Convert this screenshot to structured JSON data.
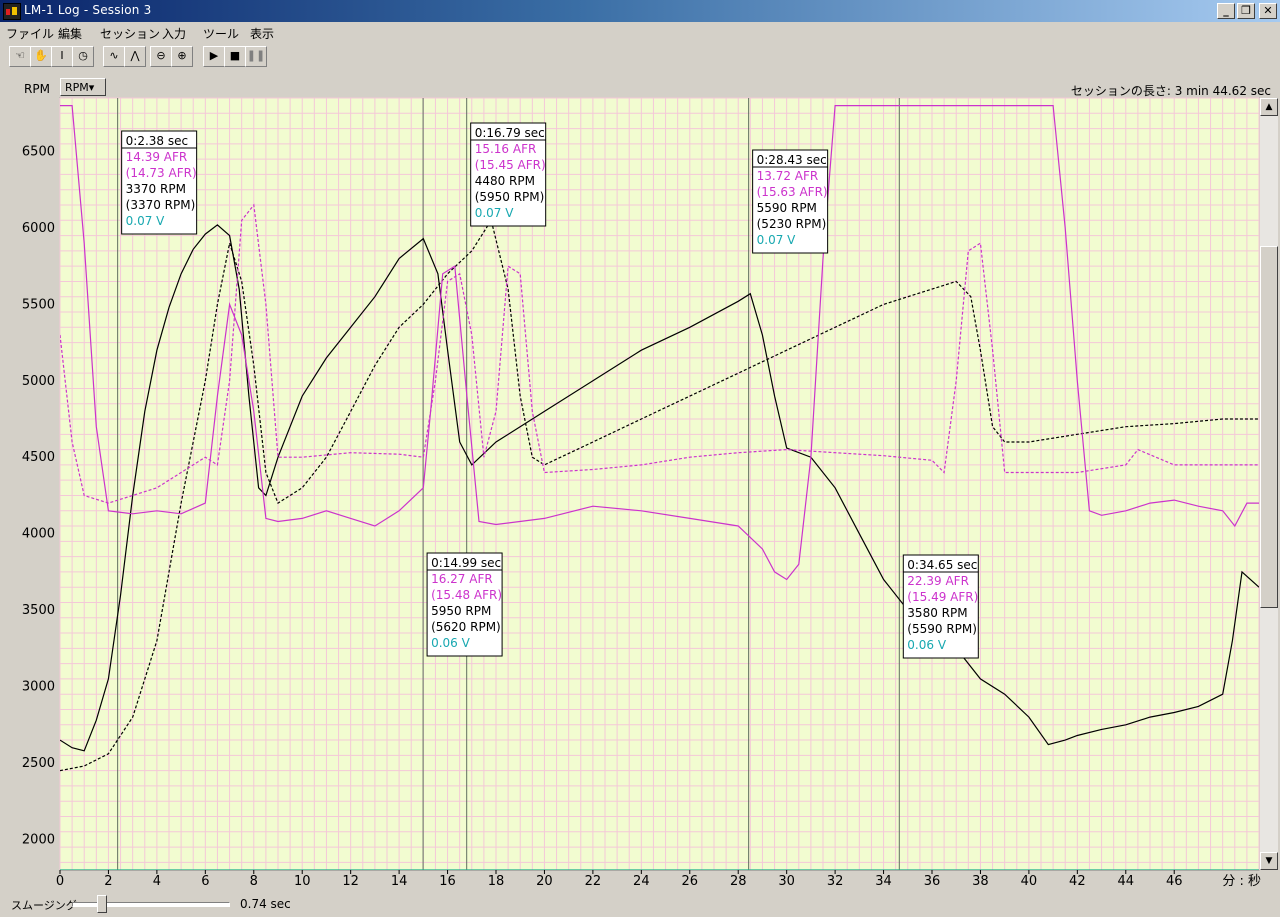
{
  "window": {
    "title": "LM-1  Log - Session 3",
    "minimize": "_",
    "restore": "❐",
    "close": "✕"
  },
  "menu": [
    "ファイル",
    "編集",
    "セッション",
    "入力",
    "ツール",
    "表示"
  ],
  "toolbar": [
    {
      "icon": "hand-icon",
      "glyph": "☜"
    },
    {
      "icon": "grab-icon",
      "glyph": "✋"
    },
    {
      "icon": "text-cursor-icon",
      "glyph": "I"
    },
    {
      "icon": "clock-icon",
      "glyph": "◷"
    },
    {
      "icon": "smooth-wave-icon",
      "glyph": "∿"
    },
    {
      "icon": "peak-wave-icon",
      "glyph": "⋀"
    },
    {
      "icon": "zoom-out-icon",
      "glyph": "⊖"
    },
    {
      "icon": "zoom-in-icon",
      "glyph": "⊕"
    },
    {
      "icon": "play-icon",
      "glyph": "▶"
    },
    {
      "icon": "stop-icon",
      "glyph": "■"
    },
    {
      "icon": "pause-icon",
      "glyph": "❚❚"
    }
  ],
  "axis_selector": {
    "label": "RPM",
    "selected": "RPM▾"
  },
  "session_length": "セッションの長さ:  3 min 44.62 sec",
  "smoothing": {
    "label": "スムージング",
    "value": "0.74 sec"
  },
  "colors": {
    "plot_bg": "#f2fcd0",
    "afr": "#cc33cc",
    "rpm": "#000000",
    "volts": "#1ab08a"
  },
  "chart_data": {
    "type": "line",
    "xlabel": "分 : 秒",
    "ylabel": "RPM",
    "xlim": [
      0,
      49.5
    ],
    "ylim": [
      1800,
      6850
    ],
    "x_ticks": [
      0,
      2,
      4,
      6,
      8,
      10,
      12,
      14,
      16,
      18,
      20,
      22,
      24,
      26,
      28,
      30,
      32,
      34,
      36,
      38,
      40,
      42,
      44,
      46
    ],
    "y_ticks": [
      2000,
      2500,
      3000,
      3500,
      4000,
      4500,
      5000,
      5500,
      6000,
      6500
    ],
    "grid": true,
    "series": [
      {
        "style": "solid",
        "color": "#000000",
        "points": [
          [
            0,
            2650
          ],
          [
            0.5,
            2600
          ],
          [
            1,
            2580
          ],
          [
            1.5,
            2780
          ],
          [
            2,
            3050
          ],
          [
            2.5,
            3600
          ],
          [
            3,
            4250
          ],
          [
            3.5,
            4800
          ],
          [
            4,
            5200
          ],
          [
            4.5,
            5480
          ],
          [
            5,
            5700
          ],
          [
            5.5,
            5860
          ],
          [
            6,
            5960
          ],
          [
            6.5,
            6020
          ],
          [
            7,
            5950
          ],
          [
            7.4,
            5600
          ],
          [
            7.8,
            4900
          ],
          [
            8.2,
            4300
          ],
          [
            8.5,
            4250
          ],
          [
            9,
            4500
          ],
          [
            10,
            4900
          ],
          [
            11,
            5150
          ],
          [
            12,
            5350
          ],
          [
            13,
            5550
          ],
          [
            14,
            5800
          ],
          [
            15,
            5930
          ],
          [
            15.6,
            5700
          ],
          [
            16,
            5200
          ],
          [
            16.5,
            4600
          ],
          [
            17,
            4450
          ],
          [
            18,
            4600
          ],
          [
            20,
            4800
          ],
          [
            22,
            5000
          ],
          [
            24,
            5200
          ],
          [
            26,
            5350
          ],
          [
            28,
            5520
          ],
          [
            28.5,
            5570
          ],
          [
            29,
            5300
          ],
          [
            29.5,
            4900
          ],
          [
            30,
            4560
          ],
          [
            31,
            4500
          ],
          [
            32,
            4300
          ],
          [
            33,
            4000
          ],
          [
            34,
            3700
          ],
          [
            35,
            3500
          ],
          [
            36,
            3450
          ],
          [
            37,
            3250
          ],
          [
            38,
            3050
          ],
          [
            39,
            2950
          ],
          [
            40,
            2800
          ],
          [
            40.8,
            2620
          ],
          [
            41.5,
            2650
          ],
          [
            42,
            2680
          ],
          [
            43,
            2720
          ],
          [
            44,
            2750
          ],
          [
            45,
            2800
          ],
          [
            46,
            2830
          ],
          [
            47,
            2870
          ],
          [
            48,
            2950
          ],
          [
            48.4,
            3300
          ],
          [
            48.8,
            3750
          ],
          [
            49.5,
            3650
          ]
        ]
      },
      {
        "style": "dashed",
        "color": "#000000",
        "points": [
          [
            0,
            2450
          ],
          [
            1,
            2480
          ],
          [
            2,
            2560
          ],
          [
            3,
            2800
          ],
          [
            4,
            3300
          ],
          [
            5,
            4200
          ],
          [
            6,
            5000
          ],
          [
            6.5,
            5500
          ],
          [
            7,
            5900
          ],
          [
            7.5,
            5650
          ],
          [
            8,
            5100
          ],
          [
            8.5,
            4400
          ],
          [
            9,
            4200
          ],
          [
            10,
            4300
          ],
          [
            11,
            4500
          ],
          [
            12,
            4800
          ],
          [
            13,
            5100
          ],
          [
            14,
            5350
          ],
          [
            15,
            5500
          ],
          [
            16,
            5700
          ],
          [
            17,
            5850
          ],
          [
            17.8,
            6050
          ],
          [
            18.5,
            5600
          ],
          [
            19,
            4900
          ],
          [
            19.5,
            4500
          ],
          [
            20,
            4450
          ],
          [
            22,
            4600
          ],
          [
            24,
            4750
          ],
          [
            26,
            4900
          ],
          [
            28,
            5050
          ],
          [
            30,
            5200
          ],
          [
            32,
            5350
          ],
          [
            34,
            5500
          ],
          [
            36,
            5600
          ],
          [
            37,
            5650
          ],
          [
            37.6,
            5550
          ],
          [
            38,
            5200
          ],
          [
            38.5,
            4700
          ],
          [
            39,
            4600
          ],
          [
            40,
            4600
          ],
          [
            42,
            4650
          ],
          [
            44,
            4700
          ],
          [
            46,
            4720
          ],
          [
            48,
            4750
          ],
          [
            49.5,
            4750
          ]
        ]
      },
      {
        "style": "solid",
        "color": "#cc33cc",
        "points": [
          [
            0,
            6800
          ],
          [
            0.5,
            6800
          ],
          [
            1,
            5900
          ],
          [
            1.5,
            4700
          ],
          [
            2,
            4150
          ],
          [
            3,
            4130
          ],
          [
            4,
            4150
          ],
          [
            5,
            4130
          ],
          [
            6,
            4200
          ],
          [
            6.5,
            4900
          ],
          [
            7,
            5500
          ],
          [
            7.5,
            5300
          ],
          [
            8,
            4800
          ],
          [
            8.5,
            4100
          ],
          [
            9,
            4080
          ],
          [
            10,
            4100
          ],
          [
            11,
            4150
          ],
          [
            12,
            4100
          ],
          [
            13,
            4050
          ],
          [
            14,
            4150
          ],
          [
            15,
            4300
          ],
          [
            15.3,
            4800
          ],
          [
            15.8,
            5700
          ],
          [
            16.3,
            5750
          ],
          [
            16.8,
            4900
          ],
          [
            17.3,
            4080
          ],
          [
            18,
            4060
          ],
          [
            20,
            4100
          ],
          [
            22,
            4180
          ],
          [
            24,
            4150
          ],
          [
            26,
            4100
          ],
          [
            28,
            4050
          ],
          [
            29,
            3900
          ],
          [
            29.5,
            3750
          ],
          [
            30,
            3700
          ],
          [
            30.5,
            3800
          ],
          [
            31,
            4500
          ],
          [
            31.5,
            5800
          ],
          [
            32,
            6800
          ],
          [
            38,
            6800
          ],
          [
            41,
            6800
          ],
          [
            41.5,
            6000
          ],
          [
            42,
            5000
          ],
          [
            42.5,
            4150
          ],
          [
            43,
            4120
          ],
          [
            44,
            4150
          ],
          [
            45,
            4200
          ],
          [
            46,
            4220
          ],
          [
            47,
            4180
          ],
          [
            48,
            4150
          ],
          [
            48.5,
            4050
          ],
          [
            49,
            4200
          ],
          [
            49.5,
            4200
          ]
        ]
      },
      {
        "style": "dashed",
        "color": "#cc33cc",
        "points": [
          [
            0,
            5300
          ],
          [
            0.5,
            4600
          ],
          [
            1,
            4250
          ],
          [
            2,
            4200
          ],
          [
            3,
            4250
          ],
          [
            4,
            4300
          ],
          [
            5,
            4400
          ],
          [
            6,
            4500
          ],
          [
            6.5,
            4450
          ],
          [
            7,
            5000
          ],
          [
            7.5,
            6050
          ],
          [
            8,
            6150
          ],
          [
            8.5,
            5500
          ],
          [
            9,
            4500
          ],
          [
            10,
            4500
          ],
          [
            12,
            4530
          ],
          [
            14,
            4520
          ],
          [
            15,
            4500
          ],
          [
            15.5,
            5000
          ],
          [
            16,
            5650
          ],
          [
            16.5,
            5700
          ],
          [
            17,
            5300
          ],
          [
            17.5,
            4500
          ],
          [
            18,
            4800
          ],
          [
            18.5,
            5750
          ],
          [
            19,
            5700
          ],
          [
            19.5,
            4800
          ],
          [
            20,
            4400
          ],
          [
            22,
            4420
          ],
          [
            24,
            4450
          ],
          [
            26,
            4500
          ],
          [
            28,
            4530
          ],
          [
            30,
            4550
          ],
          [
            32,
            4530
          ],
          [
            34,
            4510
          ],
          [
            36,
            4480
          ],
          [
            36.5,
            4400
          ],
          [
            37,
            5000
          ],
          [
            37.5,
            5850
          ],
          [
            38,
            5900
          ],
          [
            38.5,
            5200
          ],
          [
            39,
            4400
          ],
          [
            40,
            4400
          ],
          [
            42,
            4400
          ],
          [
            44,
            4450
          ],
          [
            44.5,
            4550
          ],
          [
            46,
            4450
          ],
          [
            48,
            4450
          ],
          [
            49.5,
            4450
          ]
        ]
      },
      {
        "style": "solid",
        "color": "#1ab08a",
        "points": [
          [
            0,
            1800
          ],
          [
            10,
            1800
          ],
          [
            20,
            1800
          ],
          [
            30,
            1800
          ],
          [
            40,
            1800
          ],
          [
            49.5,
            1800
          ]
        ]
      }
    ],
    "annotations": [
      {
        "x": 2.38,
        "lines": [
          "0:2.38 sec",
          "14.39 AFR",
          "(14.73 AFR)",
          "3370 RPM",
          "(3370 RPM)",
          "0.07 V"
        ]
      },
      {
        "x": 16.79,
        "lines": [
          "0:16.79 sec",
          "15.16 AFR",
          "(15.45 AFR)",
          "4480 RPM",
          "(5950 RPM)",
          "0.07 V"
        ]
      },
      {
        "x": 28.43,
        "lines": [
          "0:28.43 sec",
          "13.72 AFR",
          "(15.63 AFR)",
          "5590 RPM",
          "(5230 RPM)",
          "0.07 V"
        ]
      },
      {
        "x": 14.99,
        "lines": [
          "0:14.99 sec",
          "16.27 AFR",
          "(15.48 AFR)",
          "5950 RPM",
          "(5620 RPM)",
          "0.06 V"
        ]
      },
      {
        "x": 34.65,
        "lines": [
          "0:34.65 sec",
          "22.39 AFR",
          "(15.49 AFR)",
          "3580 RPM",
          "(5590 RPM)",
          "0.06 V"
        ]
      }
    ]
  }
}
